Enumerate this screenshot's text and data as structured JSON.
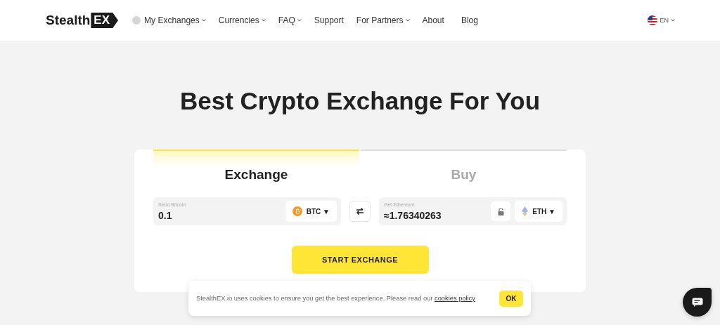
{
  "header": {
    "logo": {
      "text": "Stealth",
      "tag": "EX"
    },
    "nav": [
      {
        "label": "My Exchanges",
        "dropdown": true,
        "icon": true
      },
      {
        "label": "Currencies",
        "dropdown": true,
        "icon": false
      },
      {
        "label": "FAQ",
        "dropdown": true,
        "icon": false
      },
      {
        "label": "Support",
        "dropdown": false,
        "icon": false
      },
      {
        "label": "For Partners",
        "dropdown": true,
        "icon": false
      },
      {
        "label": "About",
        "dropdown": false,
        "icon": false
      },
      {
        "label": "Blog",
        "dropdown": false,
        "icon": false
      }
    ],
    "language": "EN"
  },
  "hero": {
    "title": "Best Crypto Exchange For You"
  },
  "tabs": [
    {
      "label": "Exchange",
      "selected": true
    },
    {
      "label": "Buy",
      "selected": false
    }
  ],
  "send": {
    "label": "Send Bitcoin",
    "value": "0.1",
    "currency": "BTC",
    "caret": "▼"
  },
  "get": {
    "label": "Get Ethereum",
    "value": "≈1.76340263",
    "currency": "ETH",
    "caret": "▼"
  },
  "start_button": "START EXCHANGE",
  "cookie_banner": {
    "text": "StealthEX.io uses cookies to ensure you get the best experience. Please read our",
    "link": "cookies policy",
    "button": "OK"
  }
}
